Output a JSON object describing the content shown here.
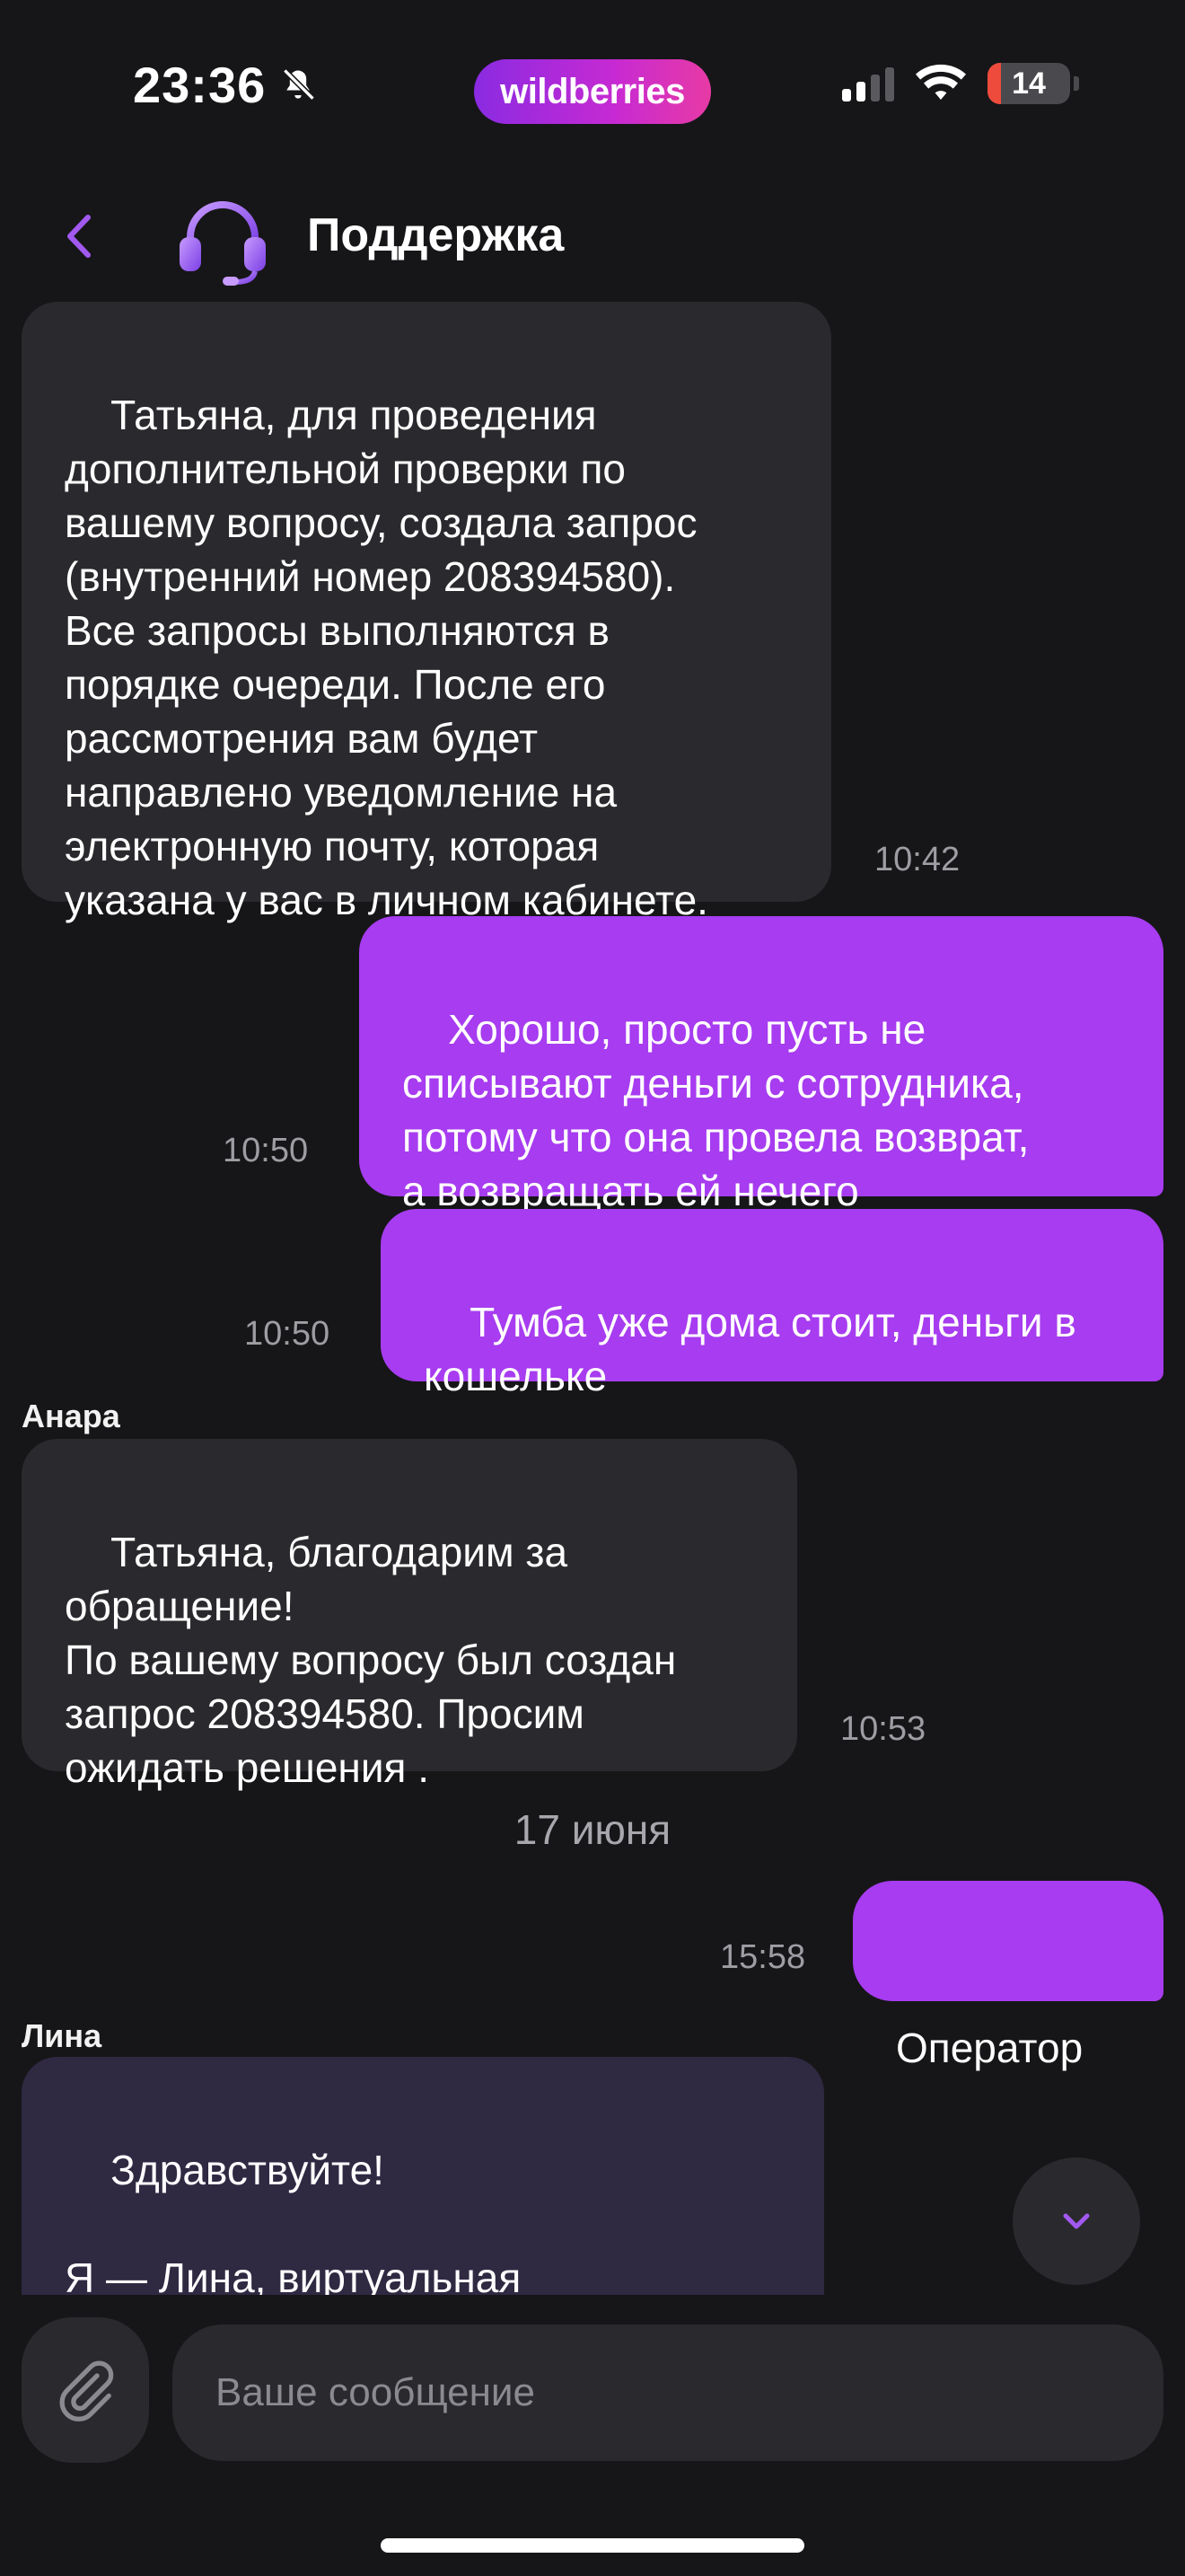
{
  "status_bar": {
    "time": "23:36",
    "brand": "wildberries",
    "battery": "14",
    "colors": {
      "brand_start": "#8a2be2",
      "brand_end": "#e83aa5",
      "battery_low": "#ef4b3c"
    },
    "icons": [
      "bell-slash-icon",
      "cellular-signal-icon",
      "wifi-icon",
      "battery-icon"
    ]
  },
  "header": {
    "title": "Поддержка",
    "icons": [
      "back-chevron-icon",
      "headset-support-icon"
    ]
  },
  "messages": [
    {
      "direction": "incoming",
      "text": "Татьяна, для проведения\nдополнительной проверки по\nвашему вопросу, создала запрос\n(внутренний номер 208394580).\nВсе запросы выполняются в\nпорядке очереди. После его\nрассмотрения вам будет\nнаправлено уведомление на\nэлектронную почту, которая\nуказана у вас в личном кабинете.",
      "time": "10:42"
    },
    {
      "direction": "outgoing",
      "text": "Хорошо, просто пусть не\nсписывают деньги с сотрудника,\nпотому что она провела возврат,\nа возвращать ей нечего",
      "time": "10:50"
    },
    {
      "direction": "outgoing",
      "text": "Тумба уже дома стоит, деньги в\nкошельке",
      "time": "10:50"
    },
    {
      "direction": "incoming",
      "sender": "Анара",
      "text": "Татьяна, благодарим за\nобращение!\nПо вашему вопросу был создан\nзапрос 208394580. Просим\nожидать решения .",
      "time": "10:53"
    },
    {
      "direction": "outgoing",
      "text": "Оператор",
      "time": "15:58"
    },
    {
      "direction": "incoming",
      "sender": "Лина",
      "text": "Здравствуйте!\n\nЯ — Лина, виртуальная\nпомощница службы поддержки."
    }
  ],
  "date_separator": "17 июня",
  "composer": {
    "placeholder": "Ваше сообщение",
    "icons": [
      "paperclip-icon",
      "chevron-down-icon"
    ]
  },
  "theme": {
    "background": "#161618",
    "incoming_bubble": "#2a2a2e",
    "bot_bubble": "#2f2942",
    "outgoing_bubble": "#a73cf0",
    "accent": "#a259f0"
  }
}
